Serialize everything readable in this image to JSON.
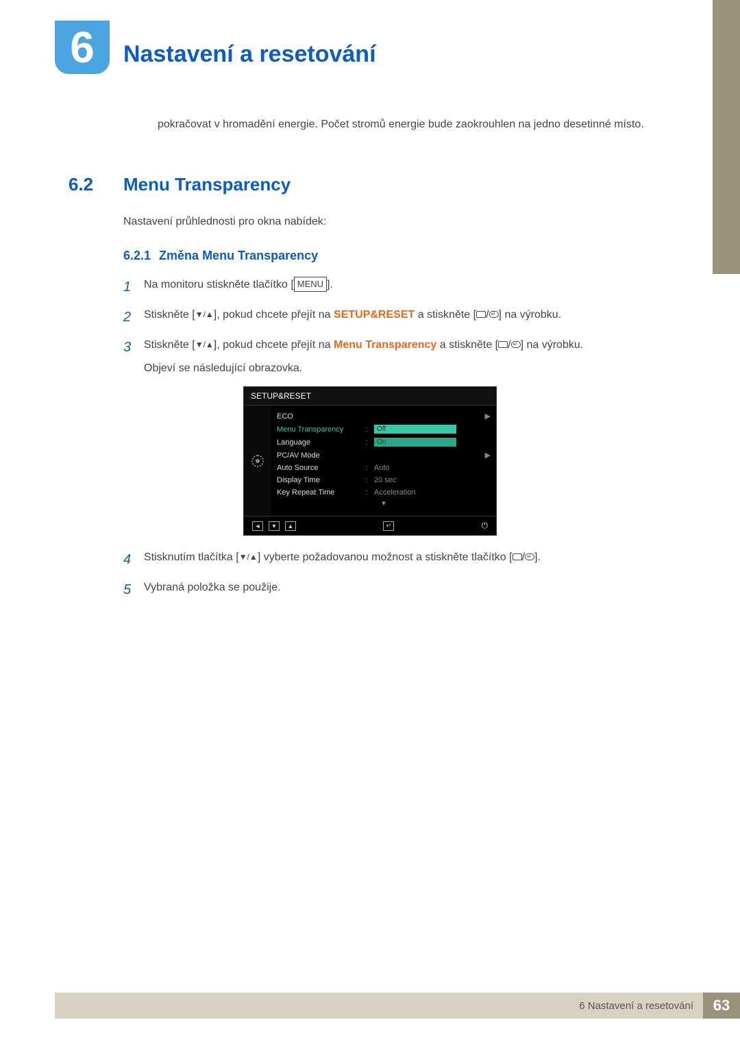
{
  "chapter": {
    "number": "6",
    "title": "Nastavení a resetování"
  },
  "intro_paragraph": "pokračovat v hromadění energie. Počet stromů energie bude zaokrouhlen na jedno desetinné místo.",
  "section": {
    "number": "6.2",
    "title": "Menu Transparency",
    "description": "Nastavení průhlednosti pro okna nabídek:"
  },
  "subsection": {
    "number": "6.2.1",
    "title": "Změna Menu Transparency"
  },
  "steps": {
    "s1": {
      "num": "1",
      "pre": "Na monitoru stiskněte tlačítko [",
      "menu": "MENU",
      "post": "]."
    },
    "s2": {
      "num": "2",
      "pre": "Stiskněte [",
      "mid": "], pokud chcete přejít na ",
      "target": "SETUP&RESET",
      "post1": " a stiskněte [",
      "post2": "] na výrobku."
    },
    "s3": {
      "num": "3",
      "pre": "Stiskněte [",
      "mid": "], pokud chcete přejít na ",
      "target": "Menu Transparency",
      "post1": " a stiskněte [",
      "post2": "] na výrobku.",
      "line2": "Objeví se následující obrazovka."
    },
    "s4": {
      "num": "4",
      "pre": "Stisknutím tlačítka [",
      "mid": "] vyberte požadovanou možnost a stiskněte tlačítko [",
      "post": "]."
    },
    "s5": {
      "num": "5",
      "text": "Vybraná položka se použije."
    }
  },
  "osd": {
    "title": "SETUP&RESET",
    "rows": [
      {
        "label": "ECO",
        "value": "",
        "arrow": true
      },
      {
        "label": "Menu Transparency",
        "value": "",
        "highlight": true,
        "options": [
          "Off",
          "On"
        ]
      },
      {
        "label": "Language",
        "value": ""
      },
      {
        "label": "PC/AV Mode",
        "value": "",
        "arrow": true
      },
      {
        "label": "Auto Source",
        "value": "Auto"
      },
      {
        "label": "Display Time",
        "value": "20 sec"
      },
      {
        "label": "Key Repeat Time",
        "value": "Acceleration"
      }
    ],
    "footer_icons": [
      "◄",
      "▼",
      "▲",
      "",
      "↵",
      "⏻"
    ]
  },
  "footer": {
    "text": "6 Nastavení a resetování",
    "page": "63"
  }
}
